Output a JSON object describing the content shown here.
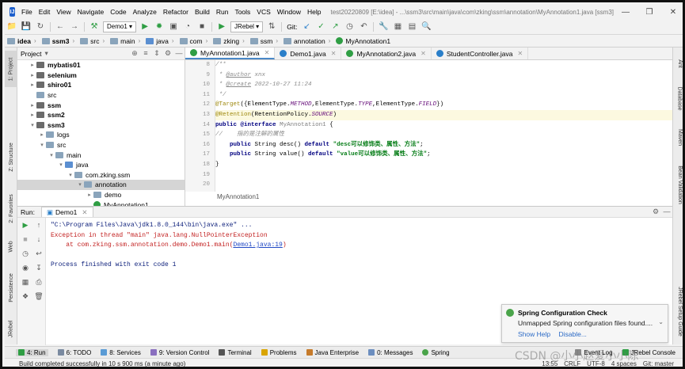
{
  "menubar": {
    "items": [
      "File",
      "Edit",
      "View",
      "Navigate",
      "Code",
      "Analyze",
      "Refactor",
      "Build",
      "Run",
      "Tools",
      "VCS",
      "Window",
      "Help"
    ],
    "window_title": "test20220809 [E:\\idea] - ...\\ssm3\\src\\main\\java\\com\\zking\\ssm\\annotation\\MyAnnotation1.java [ssm3]",
    "window_controls": [
      "—",
      "❒",
      "✕"
    ]
  },
  "toolbar": {
    "run_config": "Demo1",
    "jrebel": "JRebel",
    "git_label": "Git:"
  },
  "breadcrumb": [
    "idea",
    "ssm3",
    "src",
    "main",
    "java",
    "com",
    "zking",
    "ssm",
    "annotation",
    "MyAnnotation1"
  ],
  "left_strip": [
    "1: Project",
    "Z: Structure",
    "2: Favorites",
    "Web",
    "Persistence",
    "JRebel"
  ],
  "right_strip": [
    "Ant",
    "Database",
    "Maven",
    "Bean Validation",
    "JRebel Setup Guide"
  ],
  "project": {
    "title": "Project",
    "tree": [
      {
        "label": "mybatis01",
        "bold": true,
        "indent": 0,
        "arrow": "▸",
        "icon": "module"
      },
      {
        "label": "selenium",
        "bold": true,
        "indent": 0,
        "arrow": "▸",
        "icon": "module"
      },
      {
        "label": "shiro01",
        "bold": true,
        "indent": 0,
        "arrow": "▸",
        "icon": "module"
      },
      {
        "label": "src",
        "bold": false,
        "indent": 0,
        "arrow": "",
        "icon": "folder"
      },
      {
        "label": "ssm",
        "bold": true,
        "indent": 0,
        "arrow": "▸",
        "icon": "module"
      },
      {
        "label": "ssm2",
        "bold": true,
        "indent": 0,
        "arrow": "▸",
        "icon": "module"
      },
      {
        "label": "ssm3",
        "bold": true,
        "indent": 0,
        "arrow": "▾",
        "icon": "module"
      },
      {
        "label": "logs",
        "bold": false,
        "indent": 1,
        "arrow": "▸",
        "icon": "folder"
      },
      {
        "label": "src",
        "bold": false,
        "indent": 1,
        "arrow": "▾",
        "icon": "folder"
      },
      {
        "label": "main",
        "bold": false,
        "indent": 2,
        "arrow": "▾",
        "icon": "folder"
      },
      {
        "label": "java",
        "bold": false,
        "indent": 3,
        "arrow": "▾",
        "icon": "src"
      },
      {
        "label": "com.zking.ssm",
        "bold": false,
        "indent": 4,
        "arrow": "▾",
        "icon": "package"
      },
      {
        "label": "annotation",
        "bold": false,
        "indent": 5,
        "arrow": "▾",
        "icon": "package",
        "selected": true
      },
      {
        "label": "demo",
        "bold": false,
        "indent": 6,
        "arrow": "▸",
        "icon": "package"
      },
      {
        "label": "MyAnnotation1",
        "bold": false,
        "indent": 6,
        "arrow": "",
        "icon": "annot"
      }
    ]
  },
  "editor": {
    "tabs": [
      {
        "label": "MyAnnotation1.java",
        "active": true,
        "color": "#2f9e44"
      },
      {
        "label": "Demo1.java",
        "active": false,
        "color": "#2a7fc9"
      },
      {
        "label": "MyAnnotation2.java",
        "active": false,
        "color": "#2f9e44"
      },
      {
        "label": "StudentController.java",
        "active": false,
        "color": "#2a7fc9"
      }
    ],
    "line_numbers": [
      "8",
      "9",
      "10",
      "11",
      "12",
      "13",
      "14",
      "15",
      "16",
      "17",
      "18",
      "19",
      "20"
    ],
    "breadcrumb": "MyAnnotation1"
  },
  "run": {
    "label": "Run:",
    "tab": "Demo1",
    "console": {
      "cmd": "\"C:\\Program Files\\Java\\jdk1.8.0_144\\bin\\java.exe\" ...",
      "exception": "Exception in thread \"main\" java.lang.NullPointerException",
      "at_prefix": "    at com.zking.ssm.annotation.demo.Demo1.main(",
      "at_link": "Demo1.java:19",
      "at_suffix": ")",
      "finished": "Process finished with exit code 1"
    }
  },
  "notification": {
    "title": "Spring Configuration Check",
    "body": "Unmapped Spring configuration files found....",
    "show_help": "Show Help",
    "disable": "Disable..."
  },
  "bottom_tabs": [
    "4: Run",
    "6: TODO",
    "8: Services",
    "9: Version Control",
    "Terminal",
    "Problems",
    "Java Enterprise",
    "0: Messages",
    "Spring",
    "Event Log",
    "JRebel Console"
  ],
  "status": {
    "message": "Build completed successfully in 10 s 900 ms (a minute ago)",
    "position": "13:55",
    "line_sep": "CRLF",
    "encoding": "UTF-8",
    "indent": "4 spaces",
    "vcs": "Git: master"
  },
  "watermark": "CSDN @小小赵爱小小陈"
}
